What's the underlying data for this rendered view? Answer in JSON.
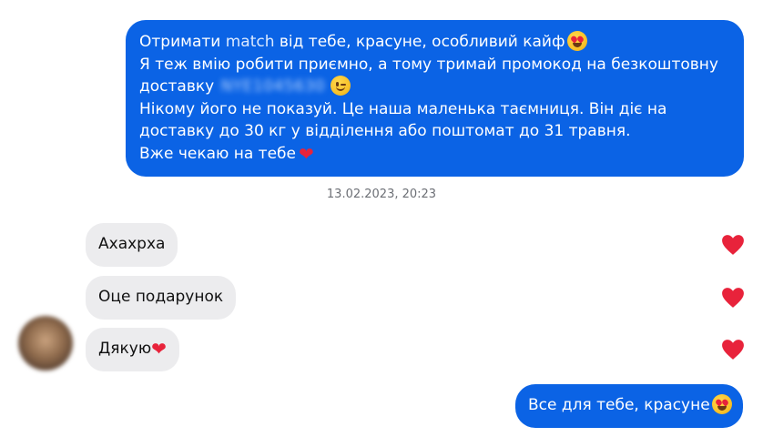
{
  "outgoing_message_1": {
    "line1_prefix": "Отримати ",
    "line1_match": "match",
    "line1_suffix": " від тебе, красуне, особливий кайф",
    "line2": "Я теж вмію робити приємно, а тому тримай промокод на безкоштовну",
    "line3_prefix": "доставку",
    "promo_code": "NYE1045630",
    "line4": "Нікому його не показуй. Це наша маленька таємниця. Він діє на",
    "line5": "доставку до 30 кг у відділення або поштомат до 31 травня.",
    "line6": "Вже чекаю на тебе",
    "emoji_heart_eyes": "heart-eyes-emoji",
    "emoji_wink": "wink-emoji",
    "emoji_heart": "❤"
  },
  "timestamp": "13.02.2023, 20:23",
  "incoming_messages": [
    {
      "text": "Ахахрха",
      "reaction": "❤"
    },
    {
      "text": "Оце подарунок",
      "reaction": "❤"
    },
    {
      "text": "Дякую",
      "emoji": "❤",
      "reaction": "❤"
    }
  ],
  "outgoing_message_2": {
    "text": "Все для тебе, красуне",
    "emoji_heart_eyes": "heart-eyes-emoji"
  },
  "colors": {
    "outgoing_bubble": "#0b63e5",
    "incoming_bubble": "#ececee",
    "heart": "#e8233b",
    "timestamp_text": "#6c6f75"
  }
}
